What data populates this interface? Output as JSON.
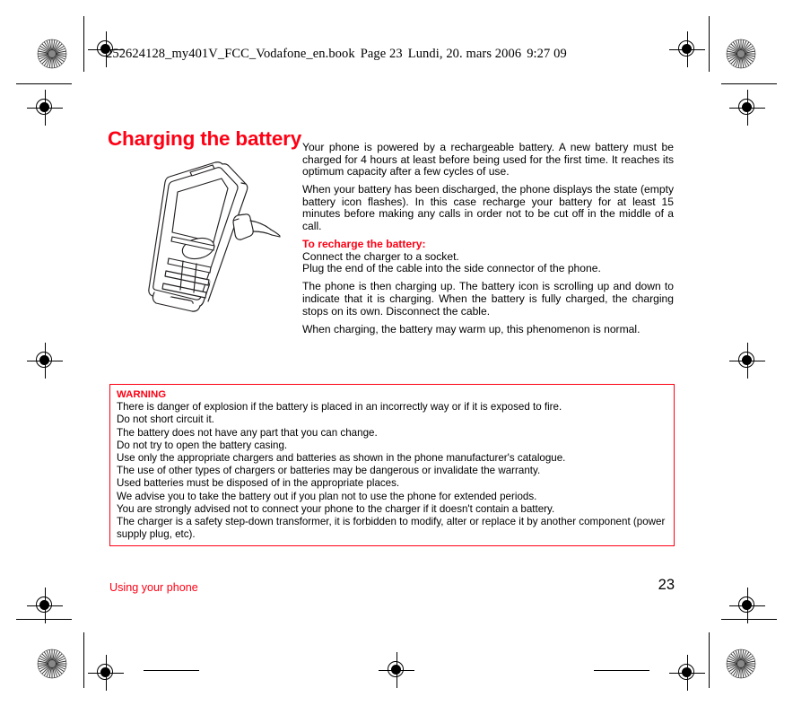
{
  "header": {
    "filename": "252624128_my401V_FCC_Vodafone_en.book",
    "page_label": "Page 23",
    "date": "Lundi, 20. mars 2006",
    "time": "9:27 09"
  },
  "title": "Charging the battery",
  "body": {
    "para1": "Your phone is powered by a rechargeable battery. A new battery must be charged for 4 hours at least before being used for the first time. It reaches its optimum capacity after a few cycles of use.",
    "para2": "When your battery has been discharged, the phone displays the state (empty battery icon flashes). In this case recharge your battery for at least 15 minutes before making any calls in order not to be cut off in the middle of a call.",
    "subhead": "To recharge the battery:",
    "step1": "Connect the charger to a socket.",
    "step2": "Plug the end of the cable into the side connector of the phone.",
    "para3": "The phone is then charging up. The battery icon is scrolling up and down to indicate that it is charging. When the battery is fully charged, the charging stops on its own. Disconnect the cable.",
    "para4": "When charging, the battery may warm up, this phenomenon is normal."
  },
  "warning": {
    "title": "WARNING",
    "lines": [
      "There is danger of explosion if the battery is placed in an incorrectly way or if it is exposed to fire.",
      "Do not short circuit it.",
      "The battery does not have any part that you can change.",
      "Do not try to open the battery casing.",
      "Use only the appropriate chargers and batteries as shown in the phone manufacturer's catalogue.",
      "The use of other types of chargers or batteries may be dangerous or invalidate the warranty.",
      "Used batteries must be disposed of in the appropriate places.",
      "We advise you to take the battery out if you plan not to use the phone for extended periods.",
      "You are strongly advised not to connect your phone to the charger if it doesn't contain a battery.",
      "The charger is a safety step-down transformer, it is forbidden to modify, alter or replace it by another component (power supply plug, etc)."
    ]
  },
  "footer": {
    "section": "Using your phone",
    "page_number": "23"
  },
  "colors": {
    "accent_red": "#ff0014",
    "text_black": "#000000",
    "page_background": "#ffffff"
  },
  "illustration": {
    "name": "phone-with-charger-cable"
  }
}
